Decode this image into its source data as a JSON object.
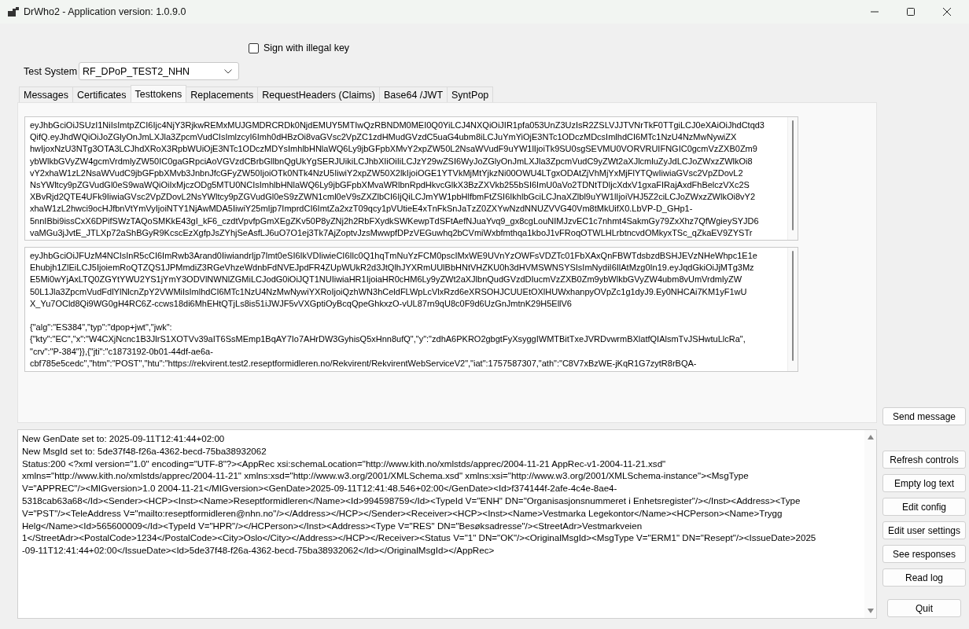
{
  "window": {
    "title": "DrWho2 - Application version: 1.0.9.0"
  },
  "sign_with_illegal_key": {
    "label": "Sign with illegal key",
    "checked": false
  },
  "test_system": {
    "label": "Test System",
    "value": "RF_DPoP_TEST2_NHN"
  },
  "tabs": [
    {
      "label": "Messages",
      "selected": false
    },
    {
      "label": "Certificates",
      "selected": false
    },
    {
      "label": "Testtokens",
      "selected": true
    },
    {
      "label": "Replacements",
      "selected": false
    },
    {
      "label": "RequestHeaders (Claims)",
      "selected": false
    },
    {
      "label": "Base64 /JWT",
      "selected": false
    },
    {
      "label": "SyntPop",
      "selected": false
    }
  ],
  "token_boxes": [
    {
      "blocks": [
        [
          "eyJhbGciOiJSUzI1NiIsImtpZCI6Ijc4NjY3RjkwREMxMUJGMDRCRDk0NjdEMUY5MTIwQzRBNDM0MEI0Q0YiLCJ4NXQiOiJIR1pfa053UnZ3UzIsR2ZSLVJJTVNrTkF0TTgiLCJ0eXAiOiJhdCtqd3",
          "QifQ.eyJhdWQiOiJoZGlyOnJmLXJla3ZpcmVudCIsImlzcyI6Imh0dHBzOi8vaGVsc2VpZC1zdHMudGVzdC5uaG4ubm8iLCJuYmYiOjE3NTc1ODczMDcsImlhdCI6MTc1NzU4NzMwNywiZX",
          "hwIjoxNzU3NTg3OTA3LCJhdXRoX3RpbWUiOjE3NTc1ODczMDYsImhlbHNlaWQ6Ly9jbGFpbXMvY2xpZW50L2NsaWVudF9uYW1lIjoiTk9SU0sgSEVMU0VORVRUIFNGIC0gcmVzZXB0Zm9",
          "ybWlkbGVyZW4gcmVrdmlyZW50IC0gaGRpciAoVGVzdCBrbGllbnQgUkYgSERJUikiLCJhbXIiOiIiLCJzY29wZSI6WyJoZGlyOnJmLXJla3ZpcmVudC9yZWt2aXJlcmluZyJdLCJoZWxzZWlkOi8",
          "vY2xhaW1zL2NsaWVudC9jbGFpbXMvb3JnbnJfcGFyZW50IjoiOTk0NTk4NzU5IiwiY2xpZW50X2lkIjoiOGE1YTVkMjMtYjkzNi00OWU4LTgxODAtZjVhMjYxMjFlYTQwIiwiaGVsc2VpZDovL2",
          "NsYWltcy9pZGVudGl0eS9waWQiOiIxMjczODg5MTU0NCIsImhlbHNlaWQ6Ly9jbGFpbXMvaWRlbnRpdHkvcGlkX3BzZXVkb255bSI6ImU0aVo2TDNtTDljcXdxV1gxaFIRajAxdFhBelczVXc2S",
          "XBvRjd2QTE4UFk9IiwiaGVsc2VpZDovL2NsYWltcy9pZGVudGl0eS9zZWN1cml0eV9sZXZlbCI6IjQiLCJmYW1pbHlfbmFtZSI6IkhlbGciLCJnaXZlbl9uYW1lIjoiVHJ5Z2ciLCJoZWxzZWlkOi8vY2",
          "xhaW1zL2hwci9ocHJfbnVtYmVyIjoiNTY1NjAwMDA5IiwiY25mIjp7ImprdCI6ImtZa2xzT09qcy1pVUtieE4xTnFkSnJaTzZ0ZXYwNzdNNUZVVG40Vm8tMkUifX0.LbVP-D_GHp1-",
          "5nnIBbi9issCxX6DPifSWzTAQoSMKkE43gI_kF6_czdtVpvfpGmXEgZKv50P8yZNj2h2RbFXydkSWKewpTdSFtAefNJuaYvq9_gx8cgLouNIMJzvEC1c7nhmt4SakmGy79ZxXhz7QfWgieySYJD6",
          "vaMGu3jJvtE_JTLXp72aShBGyR9KcscEzXgfpJsZYhjSeAsfLJ6uO7O1ej3Tk7AjZoptvJzsMwwpfDPzVEGuwhq2bCVmiWxbfmthqa1kboJ1vFRoqOTWLHLrbtncvdOMkyxTSc_qZkaEV9ZYSTr"
        ]
      ]
    },
    {
      "blocks": [
        [
          "eyJhbGciOiJFUzM4NCIsInR5cCI6ImRwb3Arand0IiwiandrIjp7Imt0eSI6IkVDIiwieCI6Ilc0Q1hqTmNuYzFCM0pscIMxWE9UVnYzOWFsVDZTc01FbXAxQnFBWTdsbzdBSHJEVzNHeWhpc1E1e",
          "Ehubjh1ZlEiLCJ5IjoiemRoQTZQS1JPMmdiZ3RGeVhzeWdnbFdNVEJpdFR4ZUpWUkR2d3JtQlhJYXRmUUlBbHNtVHZKU0h3dHVMSWNSYSIsImNydiI6IlAtMzg0In19.eyJqdGkiOiJjMTg3Mz",
          "E5Mi0wYjAxLTQ0ZGYtYWU2YS1jYmY3ODVlNWNlZGMiLCJodG0iOiJQT1NUIiwiaHR1IjoiaHR0cHM6Ly9yZWt2aXJlbnQudGVzdDIucmVzZXB0Zm9ybWlkbGVyZW4ubm8vUmVrdmlyZW",
          "50L1Jla3ZpcmVudFdlYlNlcnZpY2VWMiIsImlhdCI6MTc1NzU4NzMwNywiYXRoIjoiQzhWN3hCeldFLWpLcVlxRzd6eXRSOHJCUUEtOXlHUWxhanpyOVpZc1g1dyJ9.Ey0NHCAi7KM1yF1wU",
          "X_Yu7OCld8Qi9WG0gH4RC6Z-ccws18di6MhEHtQTjLs8is51iJWJF5vVXGptiOyBcqQpeGhkxzO-vUL87rn9qU8c0F9d6UzGnJmtnK29H5EllV6"
        ],
        [
          "{\"alg\":\"ES384\",\"typ\":\"dpop+jwt\",\"jwk\":",
          "{\"kty\":\"EC\",\"x\":\"W4CXjNcnc1B3JlrS1XOTVv39aIT6SsMEmp1BqAY7Io7AHrDW3GyhisQ5xHnn8ufQ\",\"y\":\"zdhA6PKRO2gbgtFyXsyggIWMTBitTxeJVRDvwrmBXlatfQIAlsmTvJSHwtuLlcRa\",",
          "\"crv\":\"P-384\"}},{\"jti\":\"c1873192-0b01-44df-ae6a-",
          "cbf785e5cedc\",\"htm\":\"POST\",\"htu\":\"https://rekvirent.test2.reseptformidleren.no/Rekvirent/RekvirentWebServiceV2\",\"iat\":1757587307,\"ath\":\"C8V7xBzWE-jKqR1G7zytR8rBQA-"
        ]
      ]
    }
  ],
  "log": {
    "lines": [
      "New GenDate set to: 2025-09-11T12:41:44+02:00",
      "New MsgId set to: 5de37f48-f26a-4362-becd-75ba38932062",
      "Status:200 <?xml version=\"1.0\" encoding=\"UTF-8\"?><AppRec xsi:schemaLocation=\"http://www.kith.no/xmlstds/apprec/2004-11-21 AppRec-v1-2004-11-21.xsd\"",
      "xmlns=\"http://www.kith.no/xmlstds/apprec/2004-11-21\" xmlns:xsd=\"http://www.w3.org/2001/XMLSchema.xsd\" xmlns:xsi=\"http://www.w3.org/2001/XMLSchema-instance\"><MsgType",
      "V=\"APPREC\"/><MIGversion>1.0 2004-11-21</MIGversion><GenDate>2025-09-11T12:41:48.546+02:00</GenDate><Id>f374144f-2afe-4c4e-8ae4-",
      "5318cab63a68</Id><Sender><HCP><Inst><Name>Reseptformidleren</Name><Id>994598759</Id><TypeId V=\"ENH\" DN=\"Organisasjonsnummeret i Enhetsregister\"/></Inst><Address><Type",
      "V=\"PST\"/><TeleAddress V=\"mailto:reseptformidleren@nhn.no\"/></Address></HCP></Sender><Receiver><HCP><Inst><Name>Vestmarka Legekontor</Name><HCPerson><Name>Trygg",
      "Helg</Name><Id>565600009</Id><TypeId V=\"HPR\"/></HCPerson></Inst><Address><Type V=\"RES\" DN=\"Besøksadresse\"/><StreetAdr>Vestmarkveien",
      "1</StreetAdr><PostalCode>1234</PostalCode><City>Oslo</City></Address></HCP></Receiver><Status V=\"1\" DN=\"OK\"/><OriginalMsgId><MsgType V=\"ERM1\" DN=\"Resept\"/><IssueDate>2025",
      "-09-11T12:41:44+02:00</IssueDate><Id>5de37f48-f26a-4362-becd-75ba38932062</Id></OriginalMsgId></AppRec>"
    ]
  },
  "send_button": {
    "label": "Send message"
  },
  "tool_buttons": [
    {
      "label": "Refresh controls"
    },
    {
      "label": "Empty log text"
    },
    {
      "label": "Edit config"
    },
    {
      "label": "Edit user settings"
    },
    {
      "label": "See responses"
    },
    {
      "label": "Read log"
    }
  ],
  "quit_button": {
    "label": "Quit"
  }
}
